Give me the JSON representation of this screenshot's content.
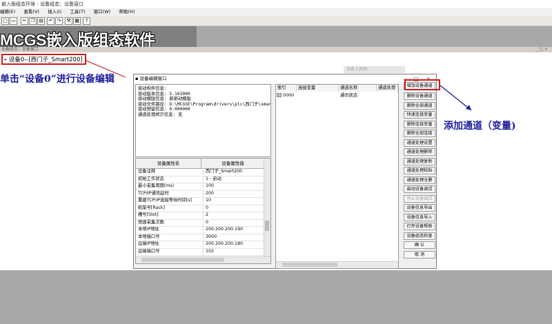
{
  "app": {
    "title": "嵌入版组态环境 - 设备组态：设备窗口",
    "menu": [
      "编辑(E)",
      "查看(V)",
      "插入(I)",
      "工具(T)",
      "窗口(W)",
      "帮助(H)"
    ],
    "banner": "MCGS嵌入版组态软件"
  },
  "workspace": {
    "title": "设备组态：设备窗口",
    "tree_node": "设备0--[西门子_Smart200]",
    "ghost_window": "设备工具箱"
  },
  "annotations": {
    "edit_device": "单击“设备0”进行设备编辑",
    "add_channel": "添加通道（变量)"
  },
  "dialog": {
    "title": "设备编辑窗口",
    "info_lines": [
      "驱动构件信息:",
      "驱动版本信息: 5.103000",
      "驱动模版信息: 新驱动模版",
      "驱动文件路径: D:\\MCGSE\\Program\\drivers\\plc\\西门子\\smart",
      "驱动预留信息: 0.000000",
      "通道处理拷贝信息: 无"
    ],
    "props_header": {
      "name": "设备属性名",
      "value": "设备属性值"
    },
    "props": [
      {
        "name": "设备注释",
        "value": "西门子_Smart200"
      },
      {
        "name": "初始工作状态",
        "value": "1 - 启动"
      },
      {
        "name": "最小采集周期(ms)",
        "value": "100"
      },
      {
        "name": "TCP/IP通讯延时",
        "value": "200"
      },
      {
        "name": "重建TCP/IP连接等待时间[s]",
        "value": "10"
      },
      {
        "name": "机架号[Rack]",
        "value": "0"
      },
      {
        "name": "槽号[Slot]",
        "value": "2"
      },
      {
        "name": "快速采集次数",
        "value": "0"
      },
      {
        "name": "本地IP地址",
        "value": "200.200.200.190"
      },
      {
        "name": "本地端口号",
        "value": "3000"
      },
      {
        "name": "远端IP地址",
        "value": "200.200.200.180"
      },
      {
        "name": "远端端口号",
        "value": "102"
      }
    ],
    "channel_headers": [
      "索引",
      "连接变量",
      "通道名称",
      "通道处理"
    ],
    "channel_rows": [
      {
        "index": "0000",
        "var": "",
        "name": "通讯状态",
        "proc": ""
      }
    ],
    "buttons": [
      {
        "label": "增加设备通道",
        "enabled": true
      },
      {
        "label": "删除设备通道",
        "enabled": true
      },
      {
        "label": "删除全部通道",
        "enabled": true
      },
      {
        "label": "快速连接变量",
        "enabled": true
      },
      {
        "label": "删除连接变量",
        "enabled": true
      },
      {
        "label": "删除全部连接",
        "enabled": true
      },
      {
        "label": "通道处理设置",
        "enabled": true
      },
      {
        "label": "通道处理删除",
        "enabled": true
      },
      {
        "label": "通道处理复制",
        "enabled": true
      },
      {
        "label": "通道处理粘贴",
        "enabled": true
      },
      {
        "label": "通道处理全删",
        "enabled": true
      },
      {
        "label": "启动设备调试",
        "enabled": true
      },
      {
        "label": "停止设备调试",
        "enabled": false
      },
      {
        "label": "设备信息导出",
        "enabled": true
      },
      {
        "label": "设备信息导入",
        "enabled": true
      },
      {
        "label": "打开设备帮助",
        "enabled": true
      },
      {
        "label": "设备组态检查",
        "enabled": true
      },
      {
        "label": "确      认",
        "enabled": true
      },
      {
        "label": "取      消",
        "enabled": true
      }
    ]
  },
  "colors": {
    "highlight": "#cc1a1a",
    "annotation": "#1c1c9c"
  }
}
